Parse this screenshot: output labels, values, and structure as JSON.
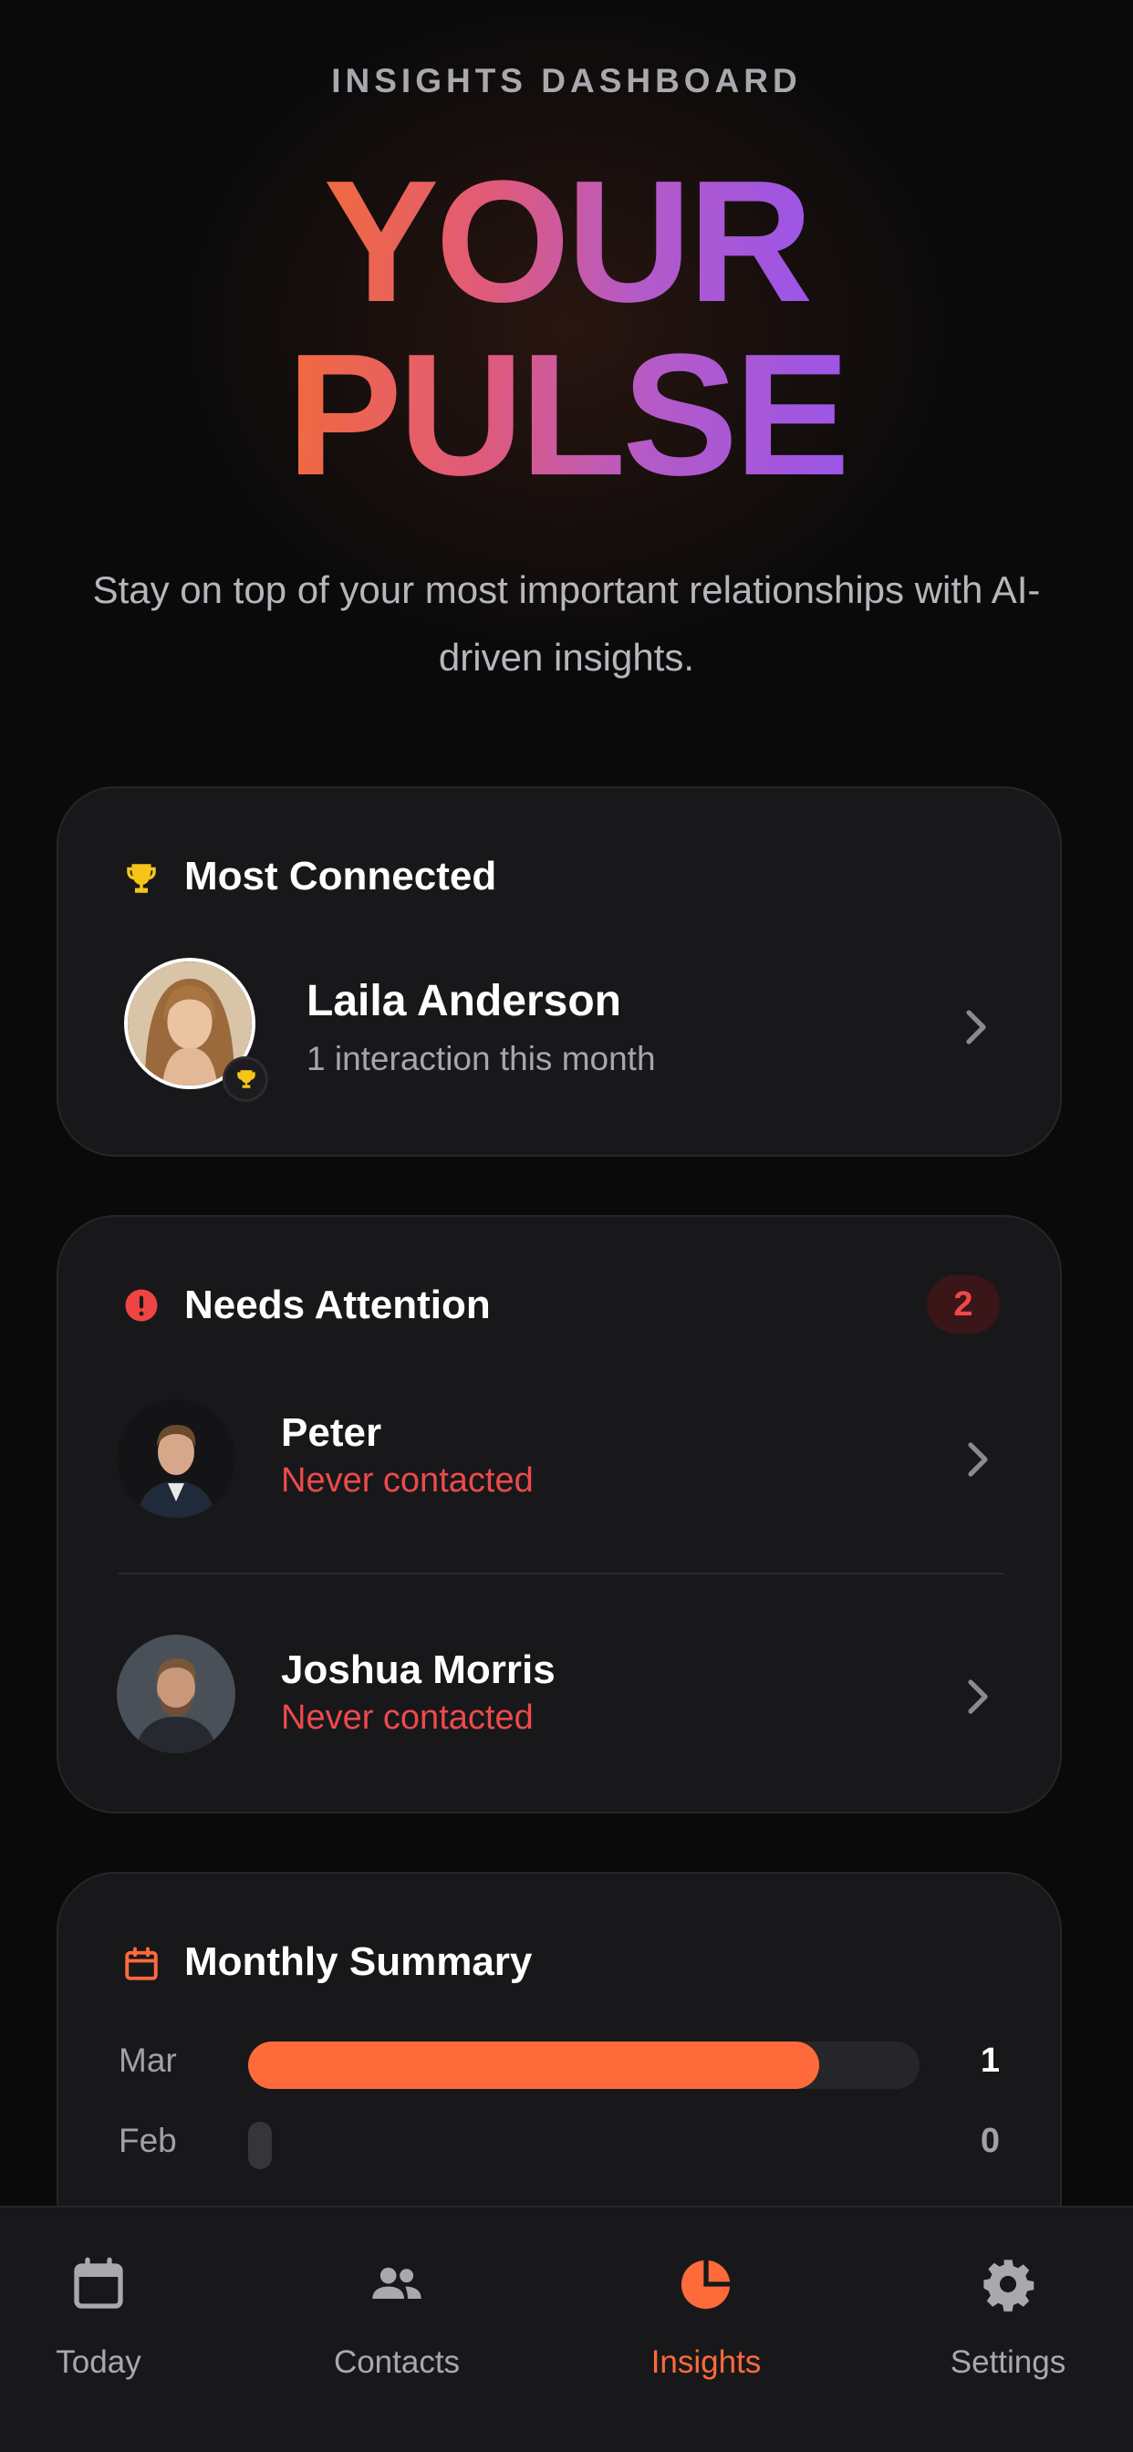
{
  "header": {
    "eyebrow": "INSIGHTS DASHBOARD",
    "title_line1": "YOUR",
    "title_line2": "PULSE",
    "subtitle": "Stay on top of your most important relationships with AI-driven insights."
  },
  "most_connected": {
    "title": "Most Connected",
    "icon": "trophy-icon",
    "person": {
      "name": "Laila Anderson",
      "detail": "1 interaction this month"
    }
  },
  "needs_attention": {
    "title": "Needs Attention",
    "icon": "alert-icon",
    "count": "2",
    "people": [
      {
        "name": "Peter",
        "status": "Never contacted"
      },
      {
        "name": "Joshua Morris",
        "status": "Never contacted"
      }
    ]
  },
  "monthly_summary": {
    "title": "Monthly Summary",
    "icon": "calendar-icon",
    "accent": "#ff6a3a",
    "rows": [
      {
        "month": "Mar",
        "value": "1",
        "fraction": 0.85
      },
      {
        "month": "Feb",
        "value": "0",
        "fraction": 0
      }
    ]
  },
  "tabbar": {
    "active": "Insights",
    "accent": "#ff6a3a",
    "tabs": [
      {
        "label": "Today",
        "icon": "calendar-icon"
      },
      {
        "label": "Contacts",
        "icon": "people-icon"
      },
      {
        "label": "Insights",
        "icon": "pie-chart-icon"
      },
      {
        "label": "Settings",
        "icon": "gear-icon"
      }
    ]
  }
}
